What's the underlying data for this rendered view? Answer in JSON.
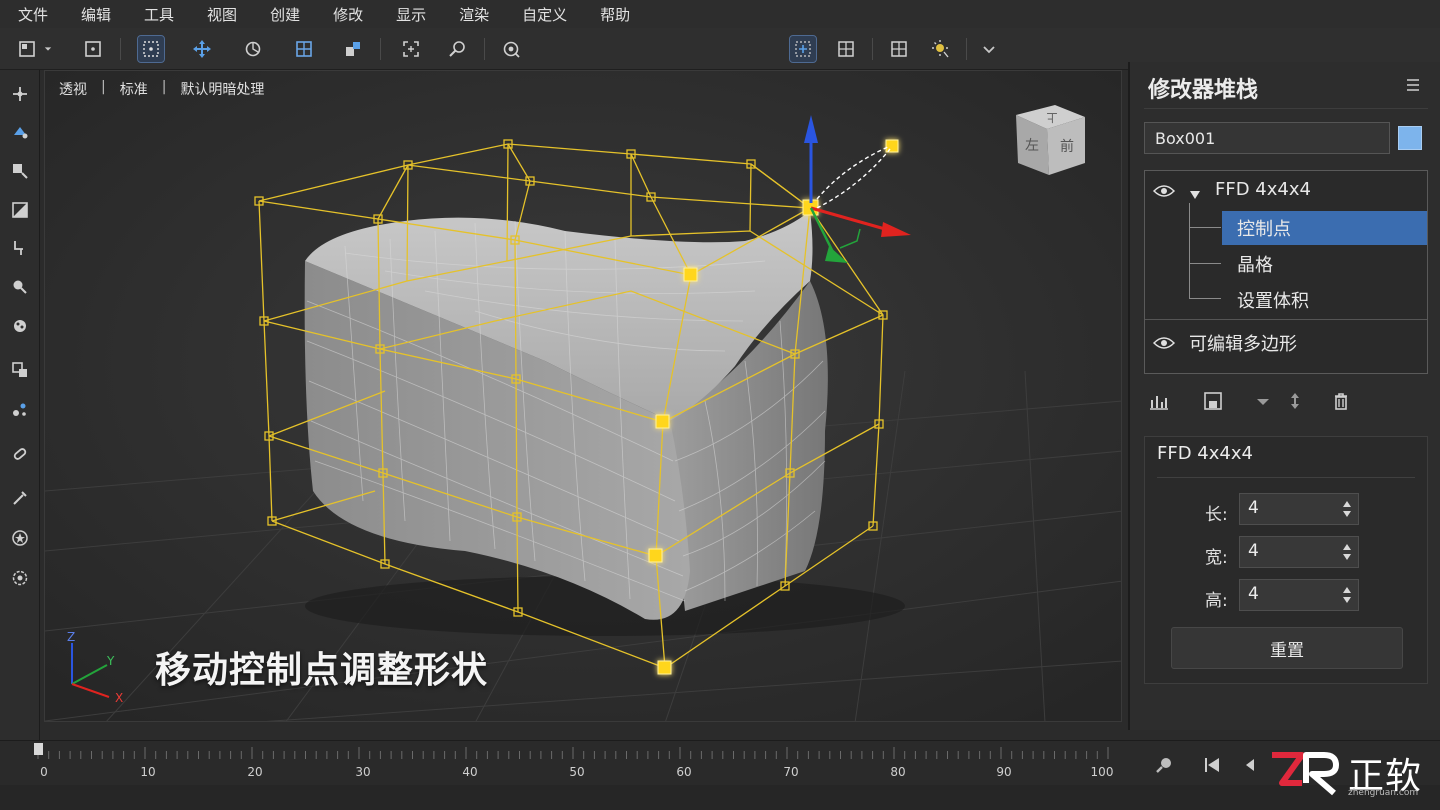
{
  "menu": [
    "文件",
    "编辑",
    "工具",
    "视图",
    "创建",
    "修改",
    "显示",
    "渲染",
    "自定义",
    "帮助"
  ],
  "viewport": {
    "label_view": "透视",
    "label_sep": "|",
    "label_mode": "标准",
    "label_shading": "默认明暗处理",
    "caption": "移动控制点调整形状",
    "viewcube_top": "上",
    "viewcube_left": "左",
    "viewcube_front": "前",
    "axis_x": "X",
    "axis_y": "Y",
    "axis_z": "Z"
  },
  "panel": {
    "title": "修改器堆栈",
    "object_name": "Box001",
    "object_color": "#7db4ec",
    "stack": {
      "modifier": "FFD 4x4x4",
      "sub_items": [
        "控制点",
        "晶格",
        "设置体积"
      ],
      "selected": "控制点",
      "base": "可编辑多边形"
    },
    "params": {
      "title": "FFD 4x4x4",
      "rows": [
        {
          "label": "长:",
          "value": "4"
        },
        {
          "label": "宽:",
          "value": "4"
        },
        {
          "label": "高:",
          "value": "4"
        }
      ],
      "reset_label": "重置"
    }
  },
  "timeline": {
    "ticks": [
      "0",
      "10",
      "20",
      "30",
      "40",
      "50",
      "60",
      "70",
      "80",
      "90",
      "100"
    ],
    "current_frame": 0
  },
  "watermark": {
    "brand": "正软",
    "url": "zhengruan.com"
  },
  "colors": {
    "lattice": "#e5c22a",
    "selection": "#3b6db0",
    "axis_x": "#e0231f",
    "axis_y": "#23a43b",
    "axis_z": "#2a55e0"
  }
}
